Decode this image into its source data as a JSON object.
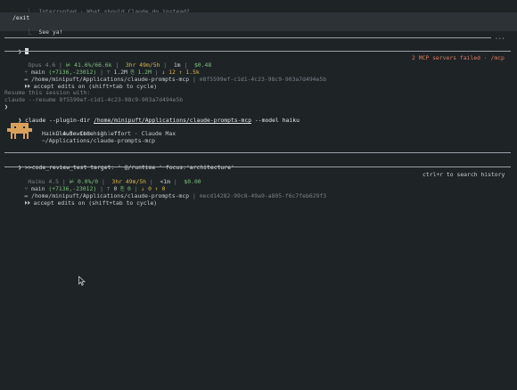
{
  "interrupt": {
    "prefix": "⎿",
    "text": "Interrupted · What should Claude do instead?"
  },
  "exit_block": {
    "command": "/exit",
    "reply_prefix": "⎿",
    "reply": "See ya!"
  },
  "prompt_top": {
    "symbol": "❯",
    "dots": "···"
  },
  "status1": {
    "model": "Opus 4.6",
    "context": "41.6%/66.6k",
    "time": "3hr 49m/5h",
    "duration": "1m",
    "cost": "$0.48",
    "mcp_warning": "2 MCP servers failed · /mcp",
    "branch": "main",
    "diff": "(+7136,-23012)",
    "tokens_in": "1.2M",
    "tokens_cache": "1.2M",
    "arrows": "12 ↑ 1.5k",
    "session_id": "8f5599ef-c1d1-4c23-98c9-903a7d494e5b",
    "folder": "/home/minipuft/Applications/claude-prompts-mcp",
    "edits": "accept edits on (shift+tab to cycle)"
  },
  "resume": {
    "line1": "Resume this session with:",
    "line2": "claude --resume 8f5599ef-c1d1-4c23-98c9-903a7d494e5b"
  },
  "command": {
    "prompt": "❯",
    "pre": "claude --plugin-dir ",
    "path": "/home/minipuft/Applications/claude-prompts-mcp",
    "post": " --model haiku"
  },
  "banner": {
    "title": "Claude Code",
    "version": "v2.1.71",
    "line2": "Haiku 4.5 with high effort · Claude Max",
    "line3": "~/Applications/claude-prompts-mcp"
  },
  "input": {
    "prompt": "❯",
    "text": ">>code_review_test target: ' @/runtime ' focus:'architecture'"
  },
  "status2": {
    "model": "Haiku 4.5",
    "context": "0.0%/0",
    "time": "3hr 49m/5h",
    "duration": "<1m",
    "cost": "$0.00",
    "search_hint": "ctrl+r to search history",
    "branch": "main",
    "diff": "(+7136,-23012)",
    "tokens_in": "0",
    "tokens_cache": "0",
    "arrows": "0 ↑ 0",
    "folder": "/home/minipuft/Applications/claude-prompts-mcp",
    "session_id": "ecd14282-99c8-49a9-a805-f6c7feb629f3",
    "edits": "accept edits on (shift+tab to cycle)"
  },
  "colors": {
    "bg": "#1e2326",
    "green": "#7ec27e",
    "yellow": "#d9b64f",
    "orange": "#e07a5f",
    "mascot": "#d9a05b"
  }
}
